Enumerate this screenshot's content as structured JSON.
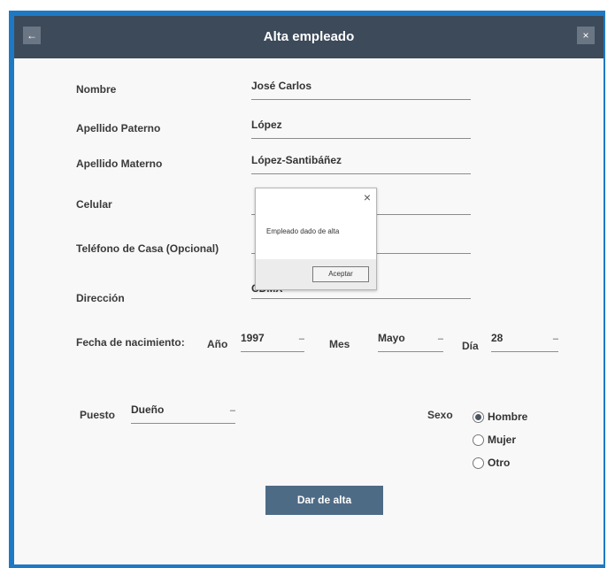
{
  "window": {
    "title": "Alta empleado"
  },
  "form": {
    "nombre": {
      "label": "Nombre",
      "value": "José Carlos"
    },
    "apellido_paterno": {
      "label": "Apellido Paterno",
      "value": "López"
    },
    "apellido_materno": {
      "label": "Apellido Materno",
      "value": "López-Santibáñez"
    },
    "celular": {
      "label": "Celular",
      "value": ""
    },
    "telefono_casa": {
      "label": "Teléfono de Casa (Opcional)",
      "value": ""
    },
    "direccion": {
      "label": "Dirección",
      "value": "CDMX"
    },
    "fecha_nacimiento": {
      "label": "Fecha de nacimiento:",
      "anio_label": "Año",
      "anio_value": "1997",
      "mes_label": "Mes",
      "mes_value": "Mayo",
      "dia_label": "Día",
      "dia_value": "28"
    },
    "puesto": {
      "label": "Puesto",
      "value": "Dueño"
    },
    "sexo": {
      "label": "Sexo",
      "options": [
        "Hombre",
        "Mujer",
        "Otro"
      ],
      "selected": "Hombre"
    },
    "submit_label": "Dar de alta"
  },
  "dialog": {
    "message": "Empleado dado de alta",
    "ok_label": "Aceptar",
    "close_glyph": "×"
  },
  "icons": {
    "back": "back-arrow-icon",
    "close": "close-icon",
    "caret": "caret-down-icon"
  },
  "colors": {
    "titlebar": "#3c4a5a",
    "frame": "#1e79c4",
    "primary_button": "#4e6b86"
  }
}
